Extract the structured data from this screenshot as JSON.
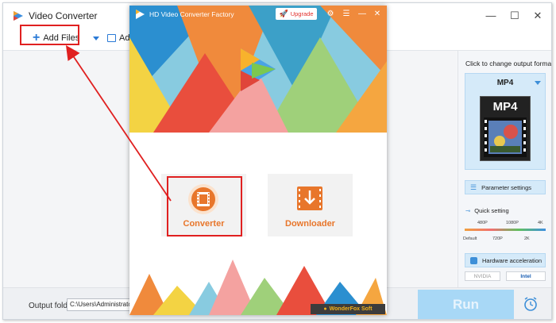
{
  "app": {
    "title": "Video Converter"
  },
  "window_controls": {
    "minimize": "—",
    "maximize": "☐",
    "close": "✕"
  },
  "toolbar": {
    "add_files": "Add Files",
    "add_folder": "Add V"
  },
  "bottom": {
    "output_label": "Output folder:",
    "output_path": "C:\\Users\\Administrator\\Des",
    "run_label": "Run"
  },
  "right_panel": {
    "change_format_label": "Click to change output format",
    "format": "MP4",
    "format_badge": "MP4",
    "parameter_settings": "Parameter settings",
    "quick_setting": "Quick setting",
    "quality_top": [
      "480P",
      "1080P",
      "4K"
    ],
    "quality_bottom": [
      "Default",
      "720P",
      "2K"
    ],
    "hardware_acceleration": "Hardware acceleration",
    "gpu_vendors": [
      "NVIDIA",
      "Intel"
    ]
  },
  "dialog": {
    "title": "HD Video Converter Factory",
    "upgrade_label": "Upgrade",
    "settings_icon": "⚙",
    "menu_icon": "☰",
    "minimize": "—",
    "close": "✕",
    "converter_label": "Converter",
    "downloader_label": "Downloader",
    "brand": "WonderFox Soft"
  },
  "colors": {
    "accent_orange": "#e8762b",
    "run_blue": "#a8d8f6",
    "highlight_red": "#e02020"
  }
}
